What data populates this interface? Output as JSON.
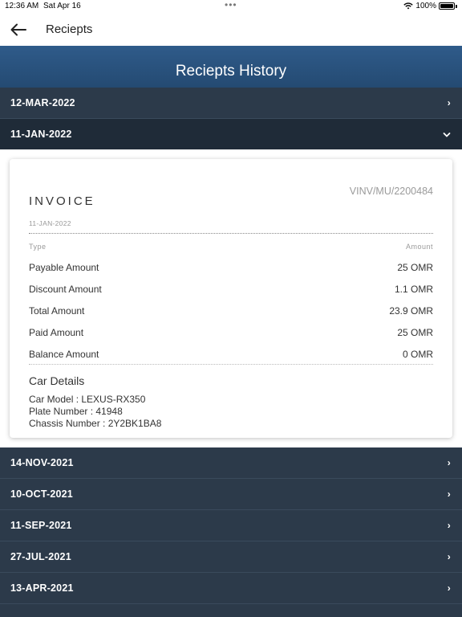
{
  "status_bar": {
    "time": "12:36 AM",
    "date": "Sat Apr 16",
    "battery": "100%"
  },
  "nav": {
    "title": "Reciepts"
  },
  "header": {
    "title": "Reciepts History"
  },
  "receipts": [
    {
      "date": "12-MAR-2022",
      "expanded": false
    },
    {
      "date": "11-JAN-2022",
      "expanded": true
    },
    {
      "date": "14-NOV-2021",
      "expanded": false
    },
    {
      "date": "10-OCT-2021",
      "expanded": false
    },
    {
      "date": "11-SEP-2021",
      "expanded": false
    },
    {
      "date": "27-JUL-2021",
      "expanded": false
    },
    {
      "date": "13-APR-2021",
      "expanded": false
    }
  ],
  "invoice": {
    "number": "VINV/MU/2200484",
    "title": "INVOICE",
    "date": "11-JAN-2022",
    "col_type": "Type",
    "col_amount": "Amount",
    "lines": [
      {
        "label": "Payable Amount",
        "value": "25 OMR"
      },
      {
        "label": "Discount Amount",
        "value": "1.1 OMR"
      },
      {
        "label": "Total Amount",
        "value": "23.9 OMR"
      },
      {
        "label": "Paid Amount",
        "value": "25 OMR"
      },
      {
        "label": "Balance Amount",
        "value": "0 OMR"
      }
    ],
    "car_details_heading": "Car Details",
    "car_model": "Car Model : LEXUS-RX350",
    "plate_number": "Plate Number : 41948",
    "chassis_number": "Chassis Number : 2Y2BK1BA8"
  },
  "icons": {
    "back": "arrow-left-icon",
    "collapsed": "chevron-right-icon",
    "expanded": "chevron-down-icon"
  },
  "colors": {
    "header_bg": "#2a527e",
    "row_bg": "#2c3a4a",
    "row_expanded_bg": "#1f2b38"
  }
}
